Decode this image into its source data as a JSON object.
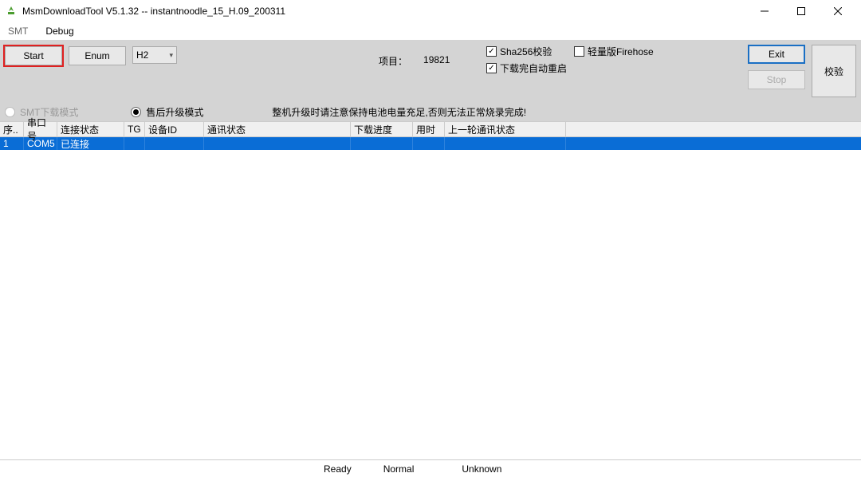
{
  "title": "MsmDownloadTool V5.1.32 -- instantnoodle_15_H.09_200311",
  "menu": {
    "smt": "SMT",
    "debug": "Debug"
  },
  "toolbar": {
    "start": "Start",
    "enum": "Enum",
    "combo": "H2",
    "project_label": "项目：",
    "project_value": "19821",
    "sha256": "Sha256校验",
    "reboot": "下载完自动重启",
    "firehose": "轻量版Firehose",
    "exit": "Exit",
    "stop": "Stop",
    "verify": "校验"
  },
  "mode": {
    "smt_mode": "SMT下载模式",
    "after_sale": "售后升级模式",
    "warning": "整机升级时请注意保持电池电量充足,否则无法正常烧录完成!"
  },
  "table": {
    "headers": {
      "seq": "序..",
      "com": "串口号",
      "conn": "连接状态",
      "tg": "TG",
      "dev": "设备ID",
      "comm": "通讯状态",
      "prog": "下载进度",
      "time": "用时",
      "last": "上一轮通讯状态"
    },
    "rows": [
      {
        "seq": "1",
        "com": "COM5",
        "conn": "已连接",
        "tg": "",
        "dev": "",
        "comm": "",
        "prog": "",
        "time": "",
        "last": ""
      }
    ]
  },
  "status": {
    "ready": "Ready",
    "normal": "Normal",
    "unknown": "Unknown"
  }
}
